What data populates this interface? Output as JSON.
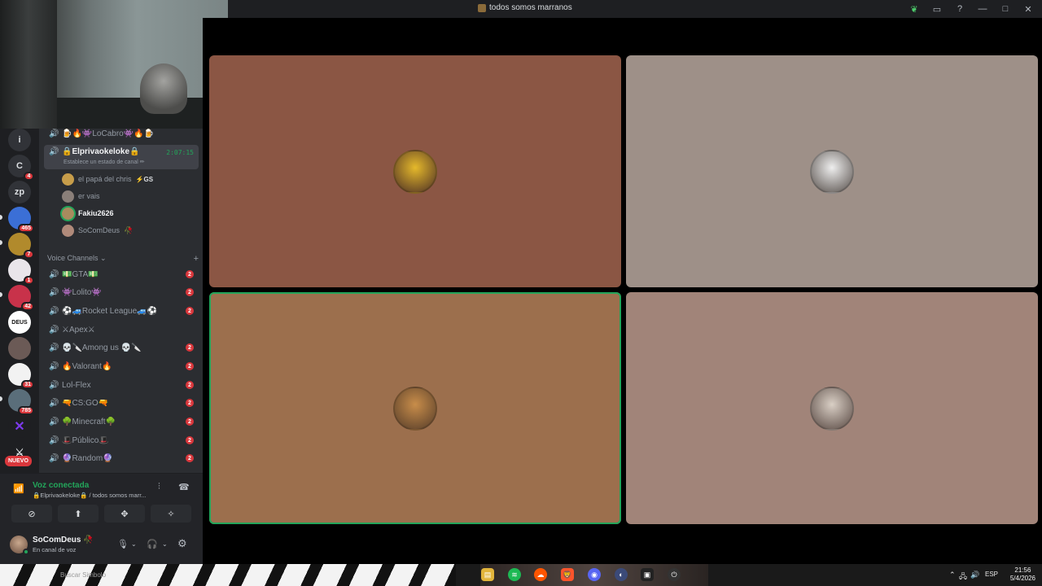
{
  "window": {
    "title": "todos somos marranos"
  },
  "guilds": {
    "items": [
      {
        "label": "i",
        "badge": ""
      },
      {
        "label": "C",
        "badge": "4"
      },
      {
        "label": "zp",
        "badge": ""
      },
      {
        "label": "",
        "badge": "465"
      },
      {
        "label": "",
        "badge": "7"
      },
      {
        "label": "",
        "badge": "1"
      },
      {
        "label": "",
        "badge": "42"
      },
      {
        "label": "DEUS",
        "badge": ""
      },
      {
        "label": "",
        "badge": ""
      },
      {
        "label": "",
        "badge": "31"
      },
      {
        "label": "",
        "badge": "785"
      },
      {
        "label": "",
        "badge": ""
      }
    ],
    "new_label": "NUEVO"
  },
  "channels": {
    "prev_channel": "🍺🔥👾LoCabro👾🔥🍺",
    "active": {
      "name": "🔒Elprivaokeloke🔒",
      "timer": "2:07:15",
      "status": "Establece un estado de canal ✏"
    },
    "members": [
      {
        "name": "el papá del chris",
        "tag": "⚡GS"
      },
      {
        "name": "er vais",
        "tag": ""
      },
      {
        "name": "Fakiu2626",
        "tag": ""
      },
      {
        "name": "SoComDeus",
        "tag": "🥀"
      }
    ],
    "section_title": "Voice Channels ⌄",
    "section_add": "+",
    "voice": [
      {
        "name": "💵GTA💵",
        "unread": "2"
      },
      {
        "name": "👾Lolito👾",
        "unread": "2"
      },
      {
        "name": "⚽🚙Rocket League🚙⚽",
        "unread": "2"
      },
      {
        "name": "⚔Apex⚔",
        "unread": ""
      },
      {
        "name": "💀🔪Among us 💀🔪",
        "unread": "2"
      },
      {
        "name": "🔥Valorant🔥",
        "unread": "2"
      },
      {
        "name": "Lol-Flex",
        "unread": "2"
      },
      {
        "name": "🔫CS:GO🔫",
        "unread": "2"
      },
      {
        "name": "🌳Minecraft🌳",
        "unread": "2"
      },
      {
        "name": "🎩Público🎩",
        "unread": "2"
      },
      {
        "name": "🔮Random🔮",
        "unread": "2"
      }
    ]
  },
  "voice_panel": {
    "status": "Voz conectada",
    "channel_path": "🔒Elprivaokeloke🔒 / todos somos marr...",
    "icons": [
      "signal-icon",
      "noise-suppression-icon",
      "disconnect-icon",
      "camera-off-icon",
      "screen-share-icon",
      "activities-icon",
      "soundboard-icon"
    ]
  },
  "user_panel": {
    "name": "SoComDeus 🥀",
    "status": "En canal de voz"
  },
  "stage": {
    "tiles": [
      {
        "color": "#8b5644",
        "avatar": "#e5b92b",
        "speaking": false
      },
      {
        "color": "#9e9088",
        "avatar": "#eeeeee",
        "speaking": false
      },
      {
        "color": "#9c6f4d",
        "avatar": "#c88d4a",
        "speaking": true
      },
      {
        "color": "#a18479",
        "avatar": "#d9cfc5",
        "speaking": false
      }
    ]
  },
  "taskbar": {
    "search": "Buscar Simbolo",
    "time": "21:56",
    "date": "5/4/2026",
    "lang": "ESP"
  }
}
